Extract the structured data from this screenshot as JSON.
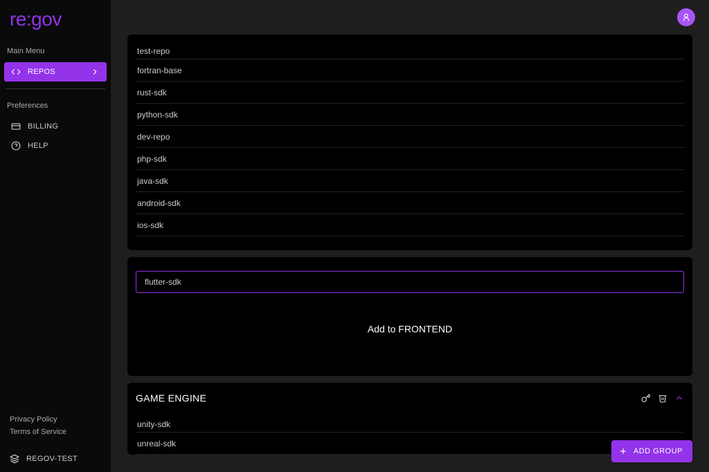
{
  "brand": "re:gov",
  "menu": {
    "main_label": "Main Menu",
    "repos_label": "REPOS",
    "prefs_label": "Preferences",
    "billing_label": "BILLING",
    "help_label": "HELP"
  },
  "footer": {
    "privacy": "Privacy Policy",
    "terms": "Terms of Service",
    "org": "REGOV-TEST"
  },
  "repo_list_1": [
    "test-repo",
    "fortran-base",
    "rust-sdk",
    "python-sdk",
    "dev-repo",
    "php-sdk",
    "java-sdk",
    "android-sdk",
    "ios-sdk"
  ],
  "new_repo_input": "flutter-sdk",
  "add_to_label": "Add to FRONTEND",
  "group2": {
    "title": "GAME ENGINE",
    "repos": [
      "unity-sdk",
      "unreal-sdk"
    ]
  },
  "add_group_label": "ADD GROUP"
}
